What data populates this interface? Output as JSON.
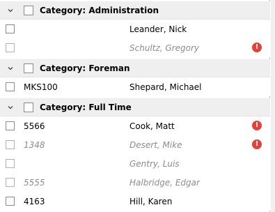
{
  "groups": [
    {
      "label": "Category: Administration",
      "rows": [
        {
          "code": "",
          "name": "Leander, Nick",
          "inactive": false,
          "alert": false
        },
        {
          "code": "",
          "name": "Schultz, Gregory",
          "inactive": true,
          "alert": true
        }
      ]
    },
    {
      "label": "Category: Foreman",
      "rows": [
        {
          "code": "MKS100",
          "name": "Shepard, Michael",
          "inactive": false,
          "alert": false
        }
      ]
    },
    {
      "label": "Category: Full Time",
      "rows": [
        {
          "code": "5566",
          "name": "Cook, Matt",
          "inactive": false,
          "alert": true
        },
        {
          "code": "1348",
          "name": "Desert, Mike",
          "inactive": true,
          "alert": true
        },
        {
          "code": "",
          "name": "Gentry, Luis",
          "inactive": true,
          "alert": false
        },
        {
          "code": "5555",
          "name": "Halbridge, Edgar",
          "inactive": true,
          "alert": false
        },
        {
          "code": "4163",
          "name": "Hill, Karen",
          "inactive": false,
          "alert": false
        }
      ]
    }
  ],
  "alert_glyph": "!",
  "colors": {
    "alert": "#e0433a",
    "inactive_text": "#8c8c8c",
    "category_bg": "#efefef"
  }
}
